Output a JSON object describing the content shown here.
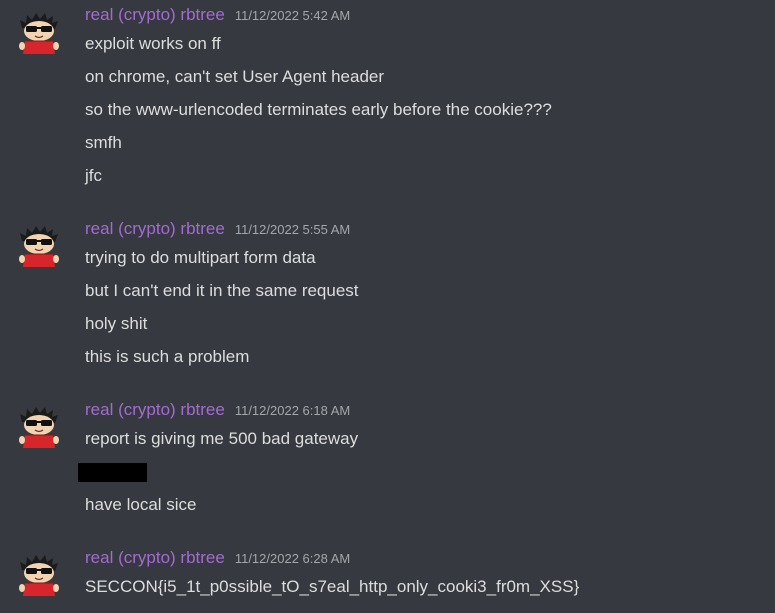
{
  "colors": {
    "background": "#36393f",
    "username": "#a36bd1",
    "timestamp": "#a3a6aa",
    "message_text": "#dcddde",
    "redaction": "#000000"
  },
  "avatar_icon": "cartoon-boy-with-sunglasses-icon",
  "groups": [
    {
      "author": "real (crypto) rbtree",
      "timestamp": "11/12/2022 5:42 AM",
      "messages": [
        "exploit works on ff",
        "on chrome, can't set User Agent header",
        "so the www-urlencoded terminates early before the cookie???",
        "smfh",
        "jfc"
      ]
    },
    {
      "author": "real (crypto) rbtree",
      "timestamp": "11/12/2022 5:55 AM",
      "messages": [
        "trying to do multipart form data",
        "but I can't end it in the same request",
        "holy shit",
        "this is such a problem"
      ]
    },
    {
      "author": "real (crypto) rbtree",
      "timestamp": "11/12/2022 6:18 AM",
      "messages": [
        "report is giving me 500 bad gateway",
        "have local sice"
      ]
    },
    {
      "author": "real (crypto) rbtree",
      "timestamp": "11/12/2022 6:28 AM",
      "messages": [
        "SECCON{i5_1t_p0ssible_tO_s7eal_http_only_cooki3_fr0m_XSS}"
      ]
    }
  ]
}
